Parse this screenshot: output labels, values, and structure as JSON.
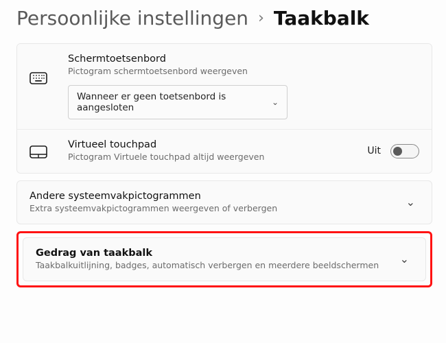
{
  "breadcrumb": {
    "root": "Persoonlijke instellingen",
    "current": "Taakbalk"
  },
  "osk": {
    "title": "Schermtoetsenbord",
    "desc": "Pictogram schermtoetsenbord weergeven",
    "selected": "Wanneer er geen toetsenbord is aangesloten"
  },
  "touchpad": {
    "title": "Virtueel touchpad",
    "desc": "Pictogram Virtuele touchpad altijd weergeven",
    "state": "Uit"
  },
  "other_icons": {
    "title": "Andere systeemvakpictogrammen",
    "desc": "Extra systeemvakpictogrammen weergeven of verbergen"
  },
  "behavior": {
    "title": "Gedrag van taakbalk",
    "desc": "Taakbalkuitlijning, badges, automatisch verbergen en meerdere beeldschermen"
  }
}
